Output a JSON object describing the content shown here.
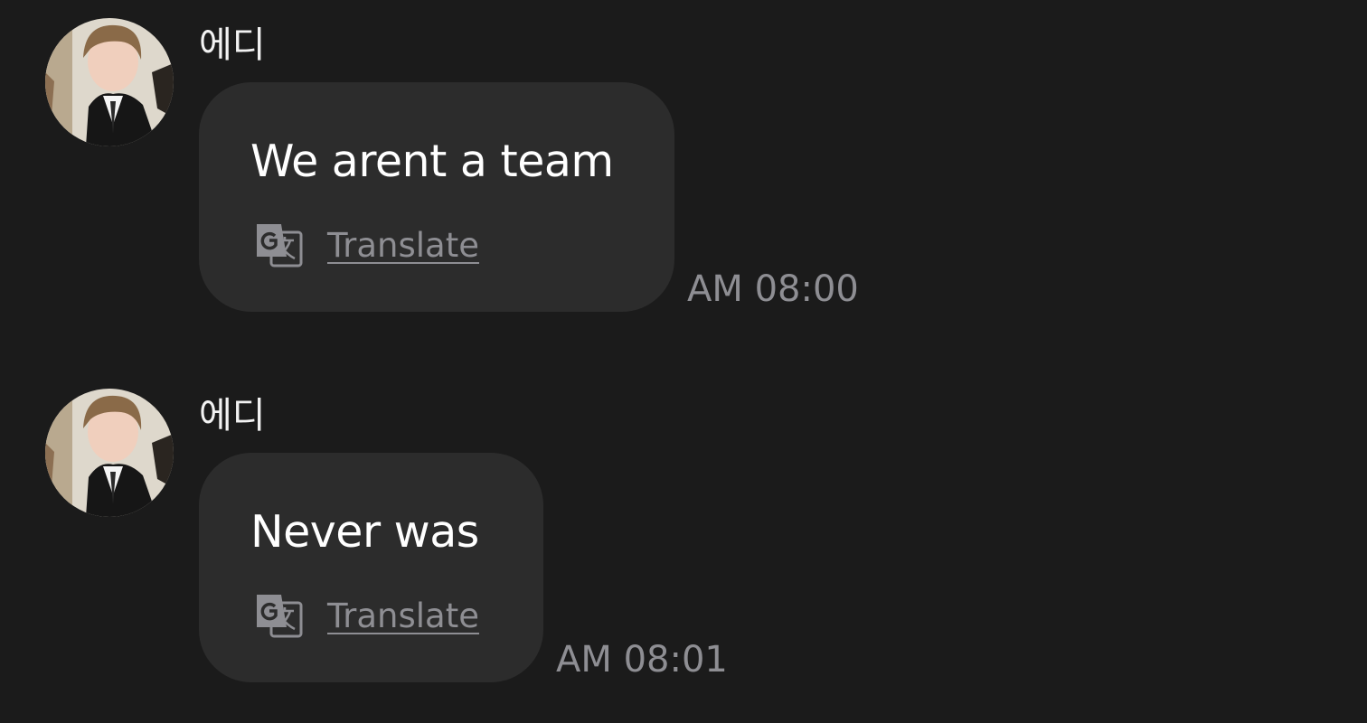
{
  "conversation": {
    "messages": [
      {
        "sender": "에디",
        "avatar_icon": "user-avatar-photo",
        "text": "We arent a team",
        "translate_label": "Translate",
        "translate_icon": "google-translate-icon",
        "time": "AM 08:00"
      },
      {
        "sender": "에디",
        "avatar_icon": "user-avatar-photo",
        "text": "Never was",
        "translate_label": "Translate",
        "translate_icon": "google-translate-icon",
        "time": "AM 08:01"
      }
    ]
  },
  "colors": {
    "background": "#1b1b1b",
    "bubble": "#2c2c2c",
    "message_text": "#ffffff",
    "secondary_text": "#8e8e93"
  }
}
